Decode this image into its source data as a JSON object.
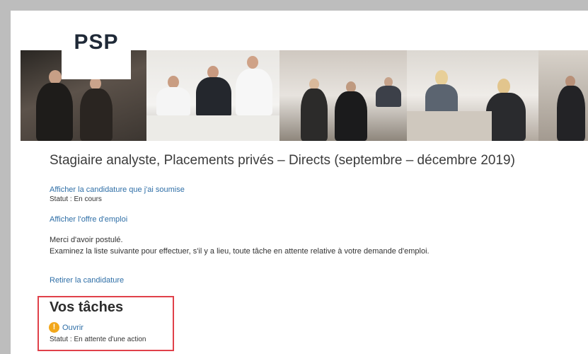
{
  "brand": {
    "logo_text": "PSP"
  },
  "job": {
    "title": "Stagiaire analyste, Placements privés – Directs (septembre – décembre 2019)"
  },
  "application": {
    "view_submitted_label": "Afficher la candidature que j'ai soumise",
    "status_text": "Statut : En cours",
    "view_offer_label": "Afficher l'offre d'emploi",
    "thanks_text": "Merci d'avoir postulé.",
    "instructions_text": "Examinez la liste suivante pour effectuer, s'il y a lieu, toute tâche en attente relative à votre demande d'emploi.",
    "withdraw_label": "Retirer la candidature"
  },
  "tasks": {
    "heading": "Vos tâches",
    "items": [
      {
        "icon": "warning-icon",
        "label": "Ouvrir",
        "status": "Statut : En attente d'une action"
      }
    ]
  },
  "colors": {
    "link": "#2f6fa7",
    "highlight_border": "#e0414a",
    "warning": "#f2a71b"
  }
}
